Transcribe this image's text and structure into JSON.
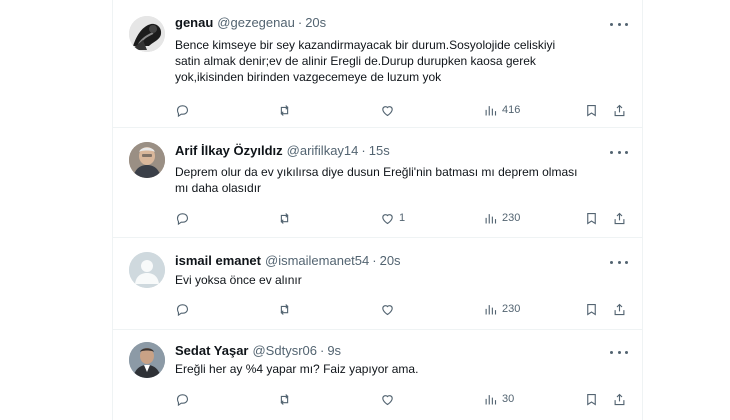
{
  "tweets": [
    {
      "name": "genau",
      "handle": "@gezegenau",
      "sep": "·",
      "time": "20s",
      "lines": [
        "Bence kimseye bir sey kazandirmayacak bir durum.Sosyolojide celiskiyi",
        "satin almak denir;ev de alinir Eregli de.Durup durupken kaosa gerek",
        "yok,ikisinden birinden vazgecemeye de luzum yok"
      ],
      "likes": "",
      "views": "416",
      "avatar": "bw-photo"
    },
    {
      "name": "Arif İlkay Özyıldız",
      "handle": "@arifilkay14",
      "sep": "·",
      "time": "15s",
      "lines": [
        "Deprem olur da ev yıkılırsa diye dusun Ereğli'nin batması mı deprem olması",
        "mı daha olasıdır"
      ],
      "likes": "1",
      "views": "230",
      "avatar": "person-photo"
    },
    {
      "name": "ismail emanet",
      "handle": "@ismailemanet54",
      "sep": "·",
      "time": "20s",
      "lines": [
        "Evi yoksa önce ev alınır"
      ],
      "likes": "",
      "views": "230",
      "avatar": "default-avatar"
    },
    {
      "name": "Sedat Yaşar",
      "handle": "@Sdtysr06",
      "sep": "·",
      "time": "9s",
      "lines": [
        "Ereğli her ay %4 yapar mı? Faiz yapıyor ama."
      ],
      "likes": "",
      "views": "30",
      "avatar": "person-photo"
    }
  ],
  "icons": {
    "reply": "reply-icon",
    "retweet": "retweet-icon",
    "like": "heart-icon",
    "views": "views-icon",
    "bookmark": "bookmark-icon",
    "share": "share-icon",
    "more": "more-icon"
  },
  "colors": {
    "text": "#0f1419",
    "muted": "#536471",
    "border": "#eff3f4",
    "default_avatar_bg": "#cfd9de"
  }
}
